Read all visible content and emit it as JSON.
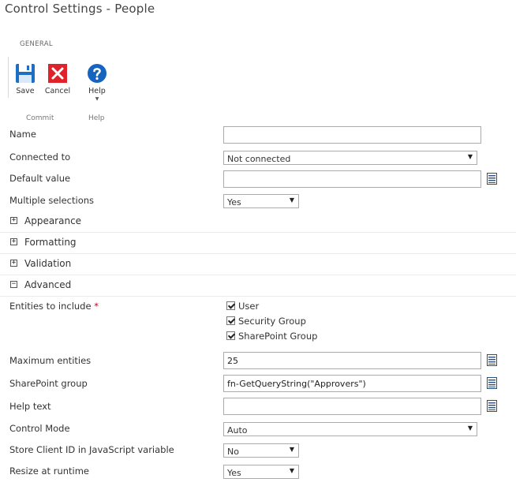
{
  "window": {
    "title": "Control Settings - People"
  },
  "ribbon": {
    "tab": "GENERAL",
    "buttons": {
      "save": "Save",
      "cancel": "Cancel",
      "help": "Help"
    },
    "groups": {
      "commit": "Commit",
      "help": "Help"
    }
  },
  "fields": {
    "name": {
      "label": "Name",
      "value": ""
    },
    "connected_to": {
      "label": "Connected to",
      "value": "Not connected"
    },
    "default_value": {
      "label": "Default value",
      "value": ""
    },
    "multiple_selections": {
      "label": "Multiple selections",
      "value": "Yes"
    }
  },
  "sections": {
    "appearance": {
      "label": "Appearance",
      "toggle": "+"
    },
    "formatting": {
      "label": "Formatting",
      "toggle": "+"
    },
    "validation": {
      "label": "Validation",
      "toggle": "+"
    },
    "advanced": {
      "label": "Advanced",
      "toggle": "−"
    }
  },
  "advanced": {
    "entities": {
      "label": "Entities to include",
      "required_mark": "*",
      "options": [
        "User",
        "Security Group",
        "SharePoint Group"
      ]
    },
    "maximum_entities": {
      "label": "Maximum entities",
      "value": "25"
    },
    "sharepoint_group": {
      "label": "SharePoint group",
      "value": "fn-GetQueryString(\"Approvers\")"
    },
    "help_text": {
      "label": "Help text",
      "value": ""
    },
    "control_mode": {
      "label": "Control Mode",
      "value": "Auto"
    },
    "store_client_id": {
      "label": "Store Client ID in JavaScript variable",
      "value": "No"
    },
    "resize_at_runtime": {
      "label": "Resize at runtime",
      "value": "Yes"
    }
  },
  "icons": {
    "save": "save-icon",
    "cancel": "cancel-icon",
    "help": "help-icon",
    "lookup": "lookup-icon"
  },
  "colors": {
    "save_blue": "#1e6fc4",
    "cancel_red": "#e0232b",
    "help_blue": "#1565c0",
    "required_red": "#c8001e"
  }
}
